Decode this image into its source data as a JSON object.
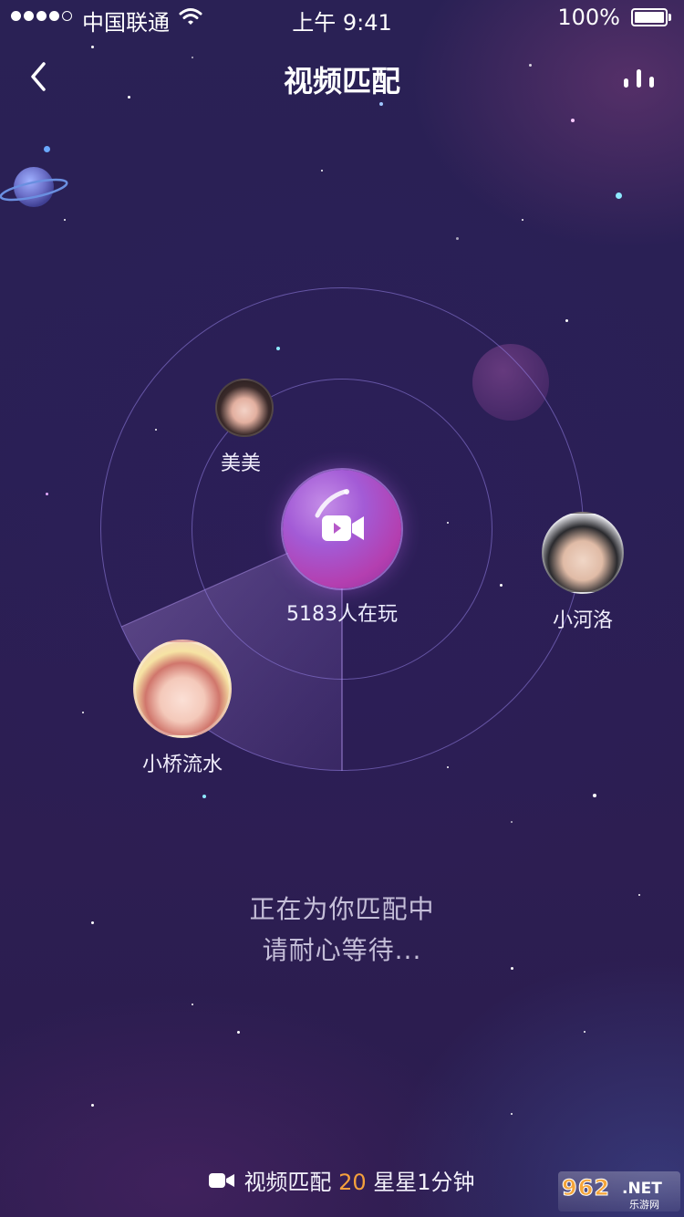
{
  "status_bar": {
    "carrier": "中国联通",
    "time": "上午 9:41",
    "battery": "100%"
  },
  "nav": {
    "title": "视频匹配",
    "back_icon": "chevron-left-icon",
    "more_icon": "bar-menu-icon"
  },
  "radar": {
    "players_count": "5183人在玩",
    "center_icon": "video-camera-icon",
    "users": [
      {
        "name": "美美"
      },
      {
        "name": "小河洛"
      },
      {
        "name": "小桥流水"
      }
    ]
  },
  "match_status": {
    "line1": "正在为你匹配中",
    "line2": "请耐心等待..."
  },
  "footer": {
    "label": "视频匹配",
    "cost": "20",
    "suffix": "星星1分钟",
    "icon": "video-camera-icon"
  },
  "watermark": "962.NET 乐游网",
  "colors": {
    "accent": "#f5a03c",
    "background": "#2a2155",
    "center_button": "#a35bd6"
  }
}
